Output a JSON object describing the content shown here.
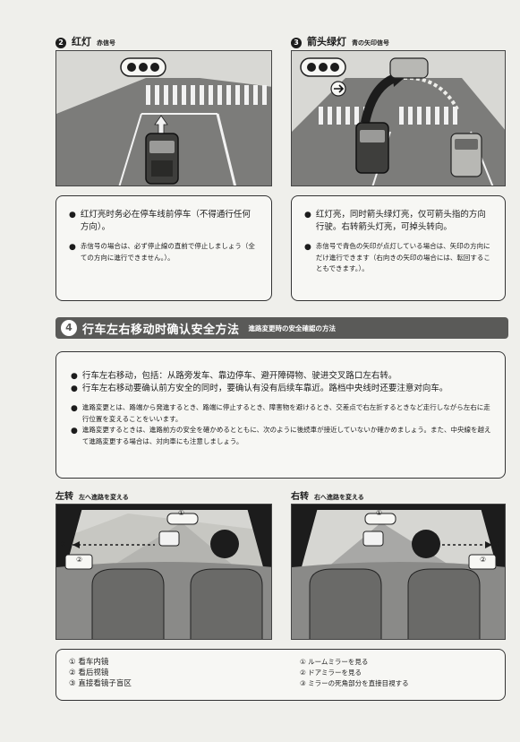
{
  "section_red": {
    "number": "2",
    "title": "红灯",
    "subtitle": "赤信号",
    "bullets_zh": [
      "红灯亮时务必在停车线前停车（不得通行任何方向）。"
    ],
    "bullets_jp": [
      "赤信号の場合は、必ず停止線の直前で停止しましょう（全ての方向に進行できません。）。"
    ]
  },
  "section_arrow": {
    "number": "3",
    "title": "箭头绿灯",
    "subtitle": "青の矢印信号",
    "bullets_zh": [
      "红灯亮，同时箭头绿灯亮，仅可箭头指的方向行驶。右转箭头灯亮，可掉头转向。"
    ],
    "bullets_jp": [
      "赤信号で青色の矢印が点灯している場合は、矢印の方向にだけ進行できます（右向きの矢印の場合には、転回することもできます。）。"
    ]
  },
  "section_lane": {
    "number": "4",
    "title": "行车左右移动时确认安全方法",
    "subtitle": "進路変更時の安全確認の方法",
    "bullets_zh": [
      "行车左右移动，包括：从路旁发车、靠边停车、避开障碍物、驶进交叉路口左右转。",
      "行车左右移动要确认前方安全的同时，要确认有没有后续车靠近。路档中央线时还要注意对向车。"
    ],
    "bullets_jp": [
      "進路変更とは、路端から発進するとき、路端に停止するとき、障害物を避けるとき、交差点で右左折するときなど走行しながら左右に走行位置を変えることをいいます。",
      "進路変更するときは、進路前方の安全を確かめるとともに、次のように後続車が接近していないか確かめましょう。また、中央線を越えて進路変更する場合は、対向車にも注意しましょう。"
    ]
  },
  "turn_left": {
    "label": "左转",
    "sub": "左へ進路を変える"
  },
  "turn_right": {
    "label": "右转",
    "sub": "右へ進路を変える"
  },
  "markers": {
    "m1": "①",
    "m2": "②",
    "m3": "③"
  },
  "legend_zh": [
    "① 看车内镜",
    "② 看后视镜",
    "③ 直接看镜子盲区"
  ],
  "legend_jp": [
    "① ルームミラーを見る",
    "② ドアミラーを見る",
    "③ ミラーの死角部分を直接目視する"
  ],
  "bullet_symbol": "●",
  "colors": {
    "banner": "#5a5a58",
    "road": "#7c7c7a",
    "paper": "#efefeb"
  }
}
